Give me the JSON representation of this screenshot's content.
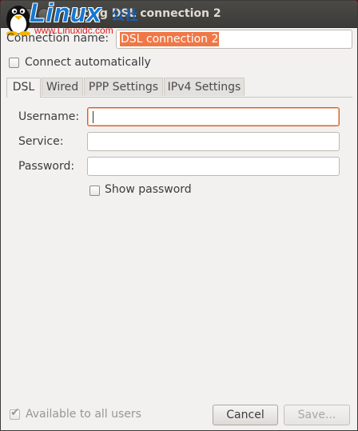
{
  "window": {
    "title": "Editing DSL connection 2"
  },
  "watermark": {
    "logo": "Linux",
    "logo_cn": "公社",
    "url": "www.Linuxidc.com"
  },
  "connection": {
    "name_label": "Connection name:",
    "name_value": "DSL connection 2",
    "auto_connect_label": "Connect automatically",
    "auto_connect_checked": false
  },
  "tabs": [
    {
      "label": "DSL",
      "active": true
    },
    {
      "label": "Wired",
      "active": false
    },
    {
      "label": "PPP Settings",
      "active": false
    },
    {
      "label": "IPv4 Settings",
      "active": false
    }
  ],
  "dsl": {
    "username_label": "Username:",
    "username_value": "",
    "service_label": "Service:",
    "service_value": "",
    "password_label": "Password:",
    "password_value": "",
    "show_password_label": "Show password",
    "show_password_checked": false
  },
  "footer": {
    "available_label": "Available to all users",
    "available_checked": true,
    "cancel_label": "Cancel",
    "save_label": "Save..."
  },
  "colors": {
    "accent": "#f07746",
    "focus_border": "#e05a2e",
    "titlebar": "#3c3b37"
  }
}
